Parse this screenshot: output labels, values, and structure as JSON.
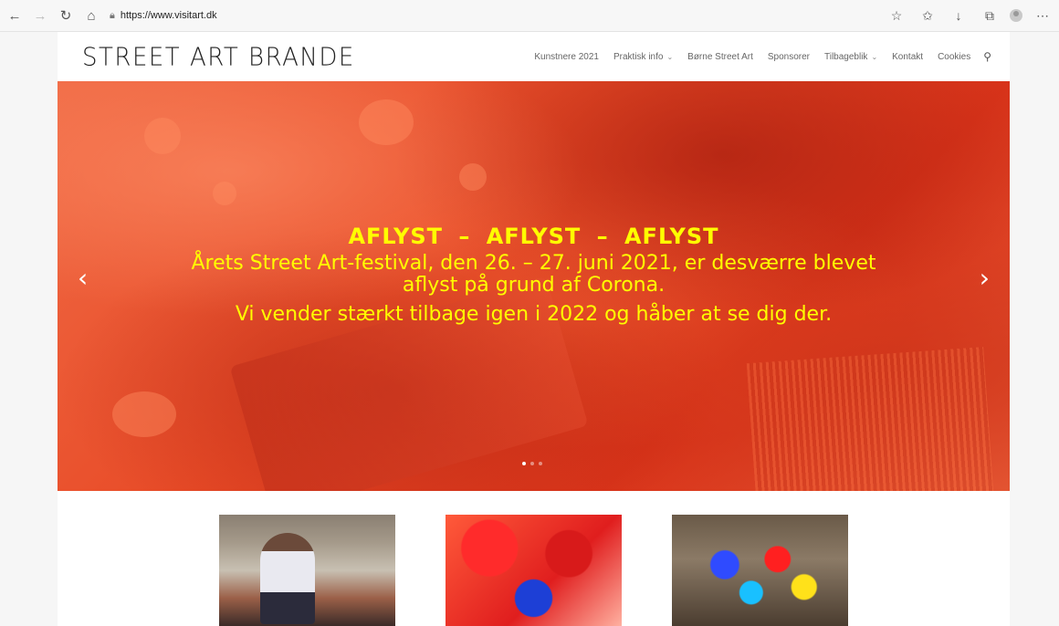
{
  "browser": {
    "url": "https://www.visitart.dk",
    "icons": [
      "back-icon",
      "forward-icon",
      "refresh-icon",
      "home-icon",
      "lock-icon",
      "read-aloud-icon",
      "favorites-star-icon",
      "downloads-icon",
      "collections-icon",
      "profile-icon",
      "more-icon"
    ]
  },
  "site": {
    "logo": "STREET ART BRANDE",
    "nav": [
      {
        "label": "Kunstnere 2021",
        "dropdown": false
      },
      {
        "label": "Praktisk info",
        "dropdown": true
      },
      {
        "label": "Børne Street Art",
        "dropdown": false
      },
      {
        "label": "Sponsorer",
        "dropdown": false
      },
      {
        "label": "Tilbageblik",
        "dropdown": true
      },
      {
        "label": "Kontakt",
        "dropdown": false
      },
      {
        "label": "Cookies",
        "dropdown": false
      }
    ]
  },
  "hero": {
    "title": "AFLYST  –  AFLYST  –  AFLYST",
    "line1": "Årets Street Art-festival, den 26. – 27. juni 2021, er desværre blevet",
    "line2": "aflyst på grund af Corona.",
    "line3": "Vi vender stærkt tilbage igen i 2022 og håber at se dig der.",
    "prev_arrow": "‹",
    "next_arrow": "›",
    "slide_count": 3,
    "active_slide": 1,
    "text_color": "#ffff00"
  }
}
